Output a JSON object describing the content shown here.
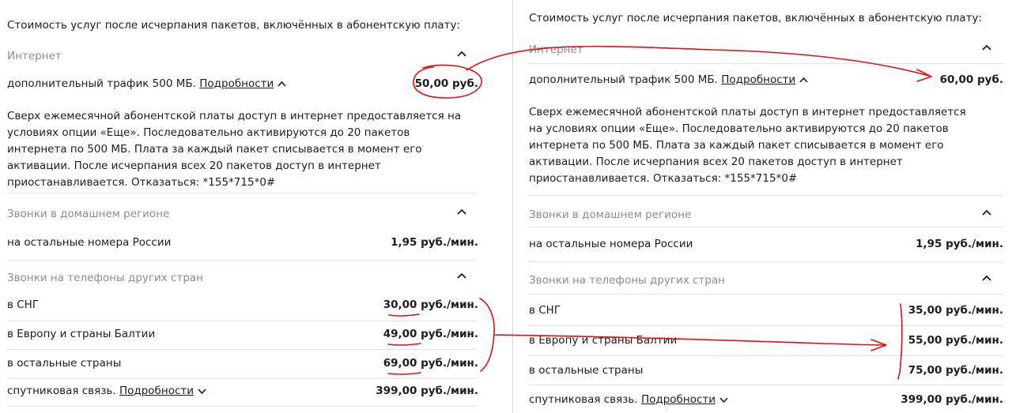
{
  "colors": {
    "text": "#1d1d1d",
    "section_header": "#8c8c8c",
    "separator": "#e2e2e2",
    "annotation_red": "#e01010"
  },
  "left": {
    "title": "Стоимость услуг после исчерпания пакетов, включённых в абонентскую плату:",
    "internet": {
      "header": "Интернет",
      "traffic_label": "дополнительный трафик 500 МБ.",
      "details_link": "Подробности",
      "traffic_price": "50,00 руб.",
      "description": [
        "Сверх ежемесячной абонентской платы доступ в интернет предоставляется на",
        "условиях опции «Еще». Последовательно активируются до 20 пакетов",
        "интернета по 500 МБ. Плата за каждый пакет списывается в момент его",
        "активации. После исчерпания всех 20 пакетов доступ в интернет",
        "приостанавливается. Отказаться: *155*715*0#"
      ]
    },
    "home_calls": {
      "header": "Звонки в домашнем регионе",
      "other_numbers_label": "на остальные номера России",
      "other_numbers_price": "1,95 руб./мин."
    },
    "intl_calls": {
      "header": "Звонки на телефоны других стран",
      "rows": [
        {
          "label": "в СНГ",
          "price": "30,00 руб./мин."
        },
        {
          "label": "в Европу и страны Балтии",
          "price": "49,00 руб./мин."
        },
        {
          "label": "в остальные страны",
          "price": "69,00 руб./мин."
        }
      ],
      "satellite_label": "спутниковая связь.",
      "satellite_link": "Подробности",
      "satellite_price": "399,00 руб./мин."
    }
  },
  "right": {
    "title": "Стоимость услуг после исчерпания пакетов, включённых в абонентскую плату:",
    "internet": {
      "header": "Интернет",
      "traffic_label": "дополнительный трафик 500 МБ.",
      "details_link": "Подробности",
      "traffic_price": "60,00 руб.",
      "description": [
        "Сверх ежемесячной абонентской платы доступ в интернет предоставляется",
        "на условиях опции «Еще». Последовательно активируются до 20 пакетов",
        "интернета по 500 МБ. Плата за каждый пакет списывается в момент его",
        "активации. После исчерпания всех 20 пакетов доступ в интернет",
        "приостанавливается. Отказаться: *155*715*0#"
      ]
    },
    "home_calls": {
      "header": "Звонки в домашнем регионе",
      "other_numbers_label": "на остальные номера России",
      "other_numbers_price": "1,95 руб./мин."
    },
    "intl_calls": {
      "header": "Звонки на телефоны других стран",
      "rows": [
        {
          "label": "в СНГ",
          "price": "35,00 руб./мин."
        },
        {
          "label": "в Европу и страны Балтии",
          "price": "55,00 руб./мин."
        },
        {
          "label": "в остальные страны",
          "price": "75,00 руб./мин."
        }
      ],
      "satellite_label": "спутниковая связь.",
      "satellite_link": "Подробности",
      "satellite_price": "399,00 руб./мин."
    }
  }
}
